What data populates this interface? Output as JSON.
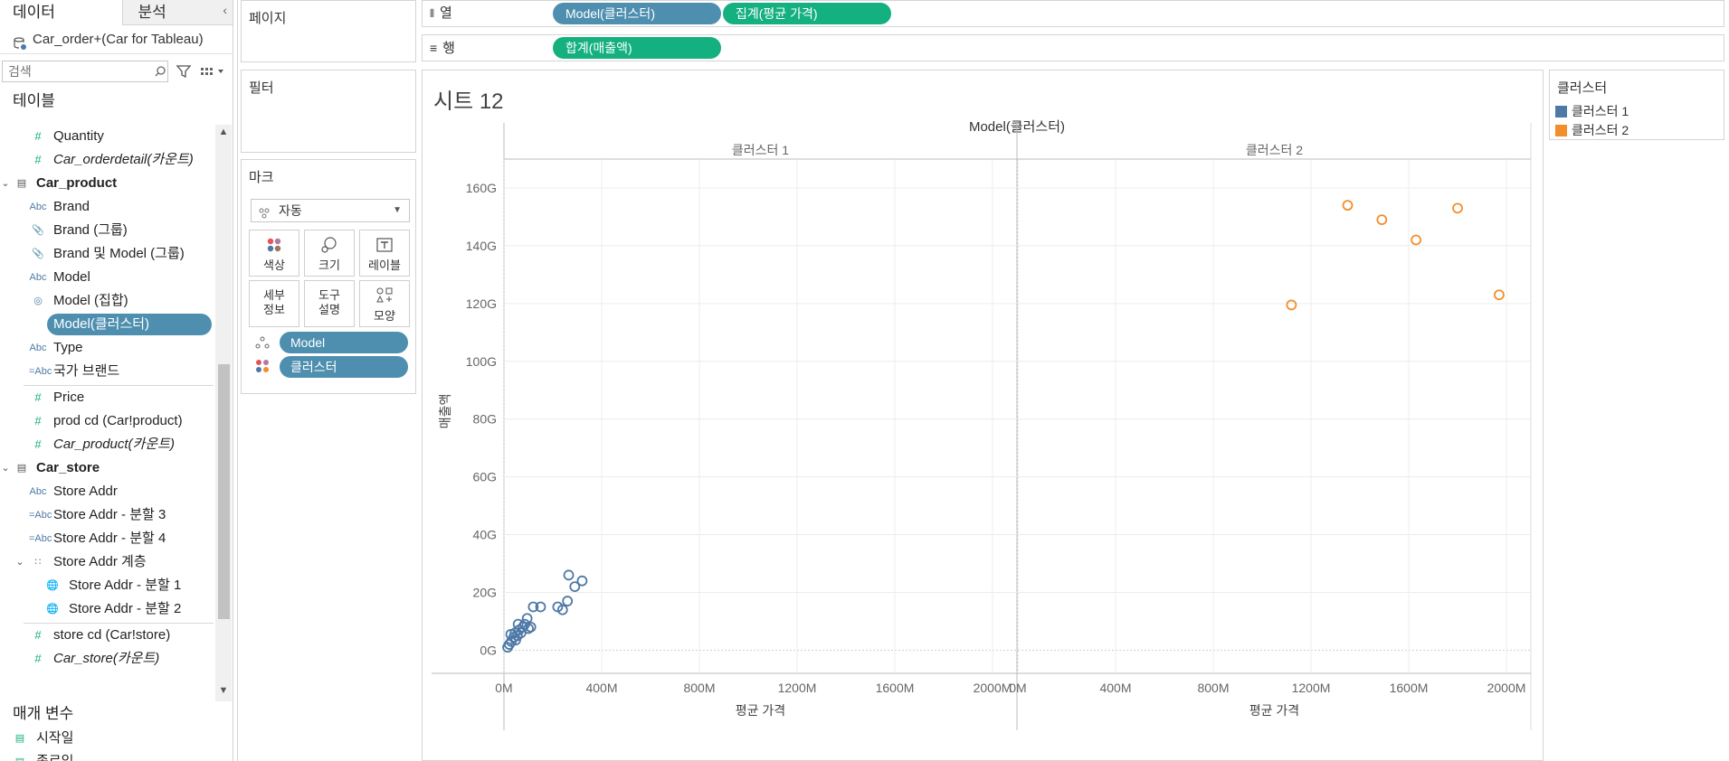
{
  "left_pane": {
    "tabs": [
      "데이터",
      "분석"
    ],
    "datasource": "Car_order+(Car for Tableau)",
    "search_placeholder": "검색",
    "tables_header": "테이블",
    "params_header": "매개 변수",
    "fields": [
      {
        "icon": "measure",
        "label": "Quantity",
        "indent": 1
      },
      {
        "icon": "measure",
        "label": "Car_orderdetail(카운트)",
        "indent": 1,
        "italic": true
      },
      {
        "icon": "table",
        "label": "Car_product",
        "indent": 0,
        "table": true
      },
      {
        "icon": "abc",
        "label": "Brand",
        "indent": 1
      },
      {
        "icon": "group",
        "label": "Brand (그룹)",
        "indent": 1
      },
      {
        "icon": "group",
        "label": "Brand 및 Model (그룹)",
        "indent": 1
      },
      {
        "icon": "abc",
        "label": "Model",
        "indent": 1
      },
      {
        "icon": "set",
        "label": "Model (집합)",
        "indent": 1
      },
      {
        "icon": "cluster",
        "label": "Model(클러스터)",
        "indent": 1,
        "selected": true
      },
      {
        "icon": "abc",
        "label": "Type",
        "indent": 1
      },
      {
        "icon": "calc-abc",
        "label": "국가 브랜드",
        "indent": 1,
        "divider_after": true
      },
      {
        "icon": "measure",
        "label": "Price",
        "indent": 1
      },
      {
        "icon": "measure",
        "label": "prod cd (Car!product)",
        "indent": 1
      },
      {
        "icon": "measure",
        "label": "Car_product(카운트)",
        "indent": 1,
        "italic": true
      },
      {
        "icon": "table",
        "label": "Car_store",
        "indent": 0,
        "table": true
      },
      {
        "icon": "abc",
        "label": "Store Addr",
        "indent": 1
      },
      {
        "icon": "calc-abc",
        "label": "Store Addr - 분할 3",
        "indent": 1
      },
      {
        "icon": "calc-abc",
        "label": "Store Addr - 분할 4",
        "indent": 1
      },
      {
        "icon": "hierarchy",
        "label": "Store Addr 계층",
        "indent": 1,
        "expand": true
      },
      {
        "icon": "geo",
        "label": "Store Addr - 분할 1",
        "indent": 2
      },
      {
        "icon": "geo",
        "label": "Store Addr - 분할 2",
        "indent": 2,
        "divider_after": true
      },
      {
        "icon": "measure",
        "label": "store cd (Car!store)",
        "indent": 1
      },
      {
        "icon": "measure",
        "label": "Car_store(카운트)",
        "indent": 1,
        "italic": true
      }
    ],
    "params": [
      {
        "icon": "calendar",
        "label": "시작일"
      },
      {
        "icon": "calendar",
        "label": "종료일"
      }
    ]
  },
  "cards": {
    "pages": "페이지",
    "filters": "필터",
    "marks": "마크",
    "mark_type": "자동",
    "buttons": [
      "색상",
      "크기",
      "레이블",
      "세부\n정보",
      "도구\n설명",
      "모양"
    ],
    "mark_fields": [
      {
        "icon": "detail",
        "label": "Model"
      },
      {
        "icon": "color",
        "label": "클러스터"
      }
    ]
  },
  "shelves": {
    "columns_label": "열",
    "rows_label": "행",
    "columns": [
      {
        "label": "Model(클러스터)",
        "color": "#4e8fb0"
      },
      {
        "label": "집계(평균 가격)",
        "color": "#14b07f"
      }
    ],
    "rows": [
      {
        "label": "합계(매출액)",
        "color": "#14b07f"
      }
    ]
  },
  "sheet_title": "시트 12",
  "legend": {
    "title": "클러스터",
    "items": [
      {
        "label": "클러스터 1",
        "color": "#4e79a7"
      },
      {
        "label": "클러스터 2",
        "color": "#f28e2b"
      }
    ]
  },
  "chart_data": {
    "type": "scatter",
    "header": "Model(클러스터)",
    "panes": [
      "클러스터 1",
      "클러스터 2"
    ],
    "xlabel": "평균 가격",
    "ylabel": "매출액",
    "x_ticks": [
      "0M",
      "400M",
      "800M",
      "1200M",
      "1600M",
      "2000M"
    ],
    "y_ticks": [
      "0G",
      "20G",
      "40G",
      "60G",
      "80G",
      "100G",
      "120G",
      "140G",
      "160G"
    ],
    "xlim": [
      0,
      2100
    ],
    "ylim": [
      -8,
      170
    ],
    "x_unit": "M",
    "y_unit": "G",
    "series": [
      {
        "name": "클러스터 1",
        "color": "#4e79a7",
        "pane": 0,
        "points": [
          [
            15,
            1
          ],
          [
            22,
            2
          ],
          [
            30,
            3
          ],
          [
            40,
            4.5
          ],
          [
            48,
            3.5
          ],
          [
            55,
            5
          ],
          [
            62,
            7
          ],
          [
            70,
            6
          ],
          [
            78,
            8
          ],
          [
            85,
            9
          ],
          [
            95,
            11
          ],
          [
            100,
            7.5
          ],
          [
            58,
            9
          ],
          [
            45,
            6
          ],
          [
            28,
            5.5
          ],
          [
            110,
            8
          ],
          [
            120,
            15
          ],
          [
            150,
            15
          ],
          [
            220,
            15
          ],
          [
            240,
            14
          ],
          [
            260,
            17
          ],
          [
            290,
            22
          ],
          [
            320,
            24
          ],
          [
            265,
            26
          ]
        ]
      },
      {
        "name": "클러스터 2",
        "color": "#f28e2b",
        "pane": 1,
        "points": [
          [
            1120,
            119.5
          ],
          [
            1350,
            154
          ],
          [
            1490,
            149
          ],
          [
            1630,
            142
          ],
          [
            1800,
            153
          ],
          [
            1970,
            123
          ]
        ]
      }
    ]
  }
}
